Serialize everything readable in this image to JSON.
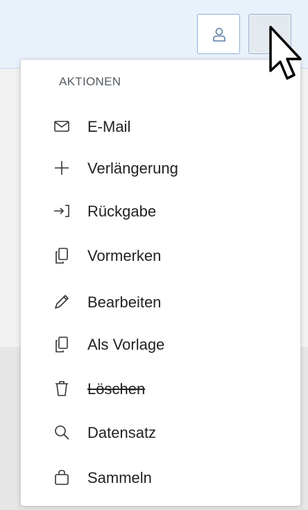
{
  "toolbar": {
    "user_icon": "user-icon",
    "more_icon": "kebab-icon"
  },
  "menu": {
    "section_title": "AKTIONEN",
    "items": [
      {
        "label": "E-Mail",
        "icon": "mail-icon"
      },
      {
        "label": "Verlängerung",
        "icon": "plus-icon"
      },
      {
        "label": "Rückgabe",
        "icon": "return-icon"
      },
      {
        "label": "Vormerken",
        "icon": "copy-icon"
      },
      {
        "label": "Bearbeiten",
        "icon": "pencil-icon"
      },
      {
        "label": "Als Vorlage",
        "icon": "copy-icon"
      },
      {
        "label": "Löschen",
        "icon": "trash-icon",
        "strikethrough": true
      },
      {
        "label": "Datensatz",
        "icon": "search-icon"
      },
      {
        "label": "Sammeln",
        "icon": "bag-icon"
      }
    ]
  },
  "colors": {
    "header_bg": "#e9f1fb",
    "button_border": "#8fb2d8",
    "text": "#222222",
    "section_title": "#545b63"
  }
}
